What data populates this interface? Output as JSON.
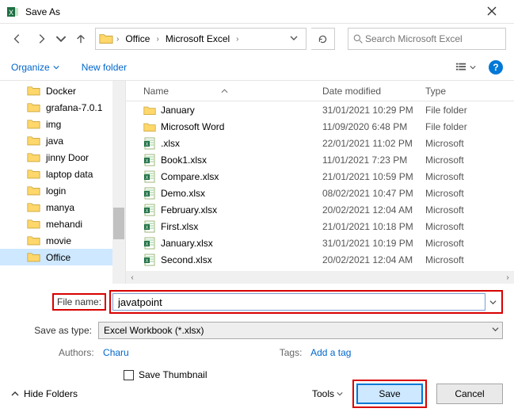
{
  "window": {
    "title": "Save As"
  },
  "breadcrumbs": {
    "item1": "Office",
    "item2": "Microsoft Excel"
  },
  "search": {
    "placeholder": "Search Microsoft Excel"
  },
  "toolbar": {
    "organize": "Organize",
    "newfolder": "New folder"
  },
  "tree": {
    "items": [
      "Docker",
      "grafana-7.0.1",
      "img",
      "java",
      "jinny Door",
      "laptop data",
      "login",
      "manya",
      "mehandi",
      "movie",
      "Office"
    ]
  },
  "columns": {
    "name": "Name",
    "date": "Date modified",
    "type": "Type"
  },
  "files": [
    {
      "icon": "folder",
      "name": "January",
      "date": "31/01/2021 10:29 PM",
      "type": "File folder"
    },
    {
      "icon": "folder",
      "name": "Microsoft Word",
      "date": "11/09/2020 6:48 PM",
      "type": "File folder"
    },
    {
      "icon": "xlsx",
      "name": ".xlsx",
      "date": "22/01/2021 11:02 PM",
      "type": "Microsoft"
    },
    {
      "icon": "xlsx",
      "name": "Book1.xlsx",
      "date": "11/01/2021 7:23 PM",
      "type": "Microsoft"
    },
    {
      "icon": "xlsx",
      "name": "Compare.xlsx",
      "date": "21/01/2021 10:59 PM",
      "type": "Microsoft"
    },
    {
      "icon": "xlsx",
      "name": "Demo.xlsx",
      "date": "08/02/2021 10:47 PM",
      "type": "Microsoft"
    },
    {
      "icon": "xlsx",
      "name": "February.xlsx",
      "date": "20/02/2021 12:04 AM",
      "type": "Microsoft"
    },
    {
      "icon": "xlsx",
      "name": "First.xlsx",
      "date": "21/01/2021 10:18 PM",
      "type": "Microsoft"
    },
    {
      "icon": "xlsx",
      "name": "January.xlsx",
      "date": "31/01/2021 10:19 PM",
      "type": "Microsoft"
    },
    {
      "icon": "xlsx",
      "name": "Second.xlsx",
      "date": "20/02/2021 12:04 AM",
      "type": "Microsoft"
    }
  ],
  "form": {
    "filename_label": "File name:",
    "filename_value": "javatpoint",
    "type_label": "Save as type:",
    "type_value": "Excel Workbook (*.xlsx)",
    "authors_label": "Authors:",
    "authors_value": "Charu",
    "tags_label": "Tags:",
    "tags_value": "Add a tag",
    "save_thumbnail": "Save Thumbnail"
  },
  "footer": {
    "hide_folders": "Hide Folders",
    "tools": "Tools",
    "save": "Save",
    "cancel": "Cancel"
  }
}
